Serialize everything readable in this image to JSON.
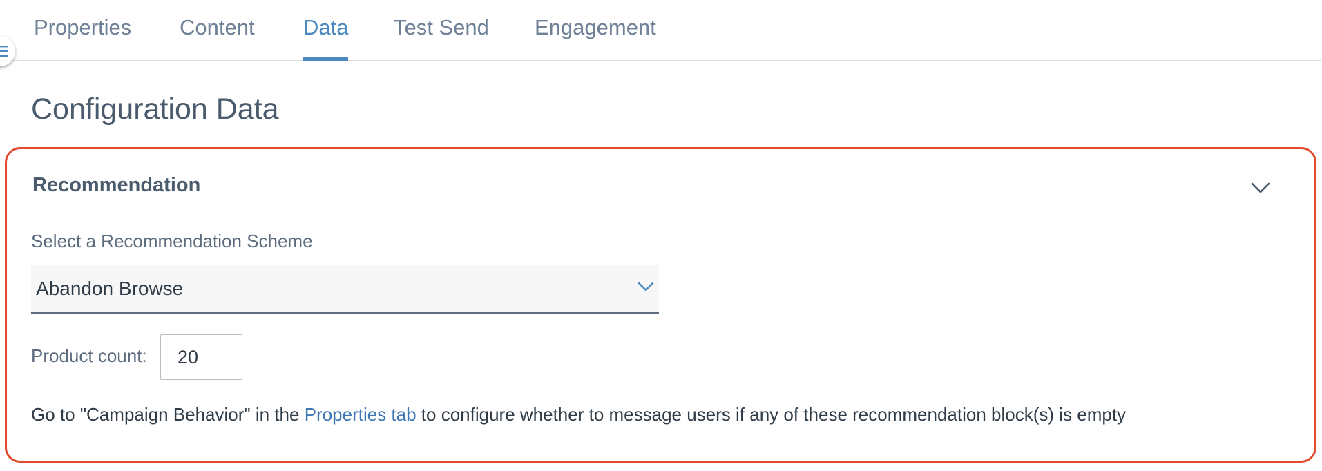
{
  "tabs": {
    "properties": "Properties",
    "content": "Content",
    "data": "Data",
    "test_send": "Test Send",
    "engagement": "Engagement",
    "active": "Data"
  },
  "page": {
    "title": "Configuration Data"
  },
  "recommendation": {
    "title": "Recommendation",
    "scheme_label": "Select a Recommendation Scheme",
    "scheme_value": "Abandon Browse",
    "count_label": "Product count:",
    "count_value": "20",
    "note_before": "Go to \"Campaign Behavior\" in the ",
    "note_link": "Properties tab",
    "note_after": " to configure whether to message users if any of these recommendation block(s) is empty"
  },
  "icons": {
    "side_toggle": "hamburger-icon",
    "collapse": "chevron-down-icon",
    "select": "chevron-down-icon"
  },
  "colors": {
    "accent": "#4c89c1",
    "highlight_border": "#e24b2e",
    "link": "#3e77b3"
  }
}
